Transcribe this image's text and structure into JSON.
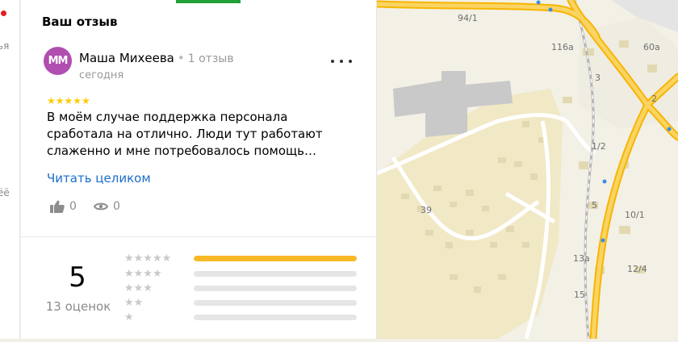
{
  "left_panel": {
    "fragments": [
      "ья",
      "ёё"
    ]
  },
  "review": {
    "section_title": "Ваш отзыв",
    "avatar_initials": "ММ",
    "avatar_color": "#b04fb0",
    "author": "Маша Михеева",
    "separator": "•",
    "review_count": "1 отзыв",
    "date": "сегодня",
    "stars": "★★★★★",
    "text": "В моём случае поддержка персонала сработала на отлично. Люди тут работают слаженно и мне потребовалось помощь…",
    "read_more": "Читать целиком",
    "likes": "0",
    "views": "0"
  },
  "rating": {
    "value": "5",
    "count_label": "13 оценок",
    "distribution": [
      {
        "stars": "★★★★★",
        "fraction": 1.0
      },
      {
        "stars": "★★★★",
        "fraction": 0
      },
      {
        "stars": "★★★",
        "fraction": 0
      },
      {
        "stars": "★★",
        "fraction": 0
      },
      {
        "stars": "★",
        "fraction": 0
      }
    ],
    "star_color_filled": "#fc0",
    "bar_color": "#f9b826"
  },
  "map": {
    "labels": [
      "94/1",
      "116а",
      "60а",
      "3",
      "2",
      "1/2",
      "39",
      "5",
      "10/1",
      "13а",
      "12/4",
      "15"
    ]
  }
}
